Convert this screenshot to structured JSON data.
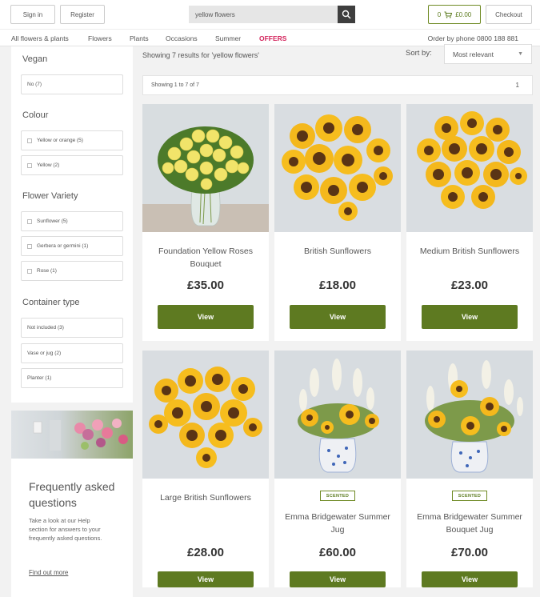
{
  "header": {
    "sign_in": "Sign in",
    "register": "Register",
    "search_value": "yellow flowers",
    "basket_count": "0",
    "basket_total": "£0.00",
    "checkout": "Checkout"
  },
  "nav": {
    "items": [
      "All flowers & plants",
      "Flowers",
      "Plants",
      "Occasions",
      "Summer",
      "OFFERS"
    ],
    "phone": "Order by phone 0800 188 881"
  },
  "filters": {
    "vegan": {
      "heading": "Vegan",
      "options": [
        "No (7)"
      ]
    },
    "colour": {
      "heading": "Colour",
      "options": [
        "Yellow or orange (5)",
        "Yellow (2)"
      ]
    },
    "variety": {
      "heading": "Flower Variety",
      "options": [
        "Sunflower (5)",
        "Gerbera or germini (1)",
        "Rose (1)"
      ]
    },
    "container": {
      "heading": "Container type",
      "options": [
        "Not included (3)",
        "Vase or jug (2)",
        "Planter (1)"
      ]
    }
  },
  "faq": {
    "title": "Frequently asked questions",
    "text": "Take a look at our Help section for answers to your frequently asked questions.",
    "link": "Find out more"
  },
  "results": {
    "summary": "Showing 7 results for 'yellow flowers'",
    "sort_label": "Sort by:",
    "sort_value": "Most relevant",
    "paging_text": "Showing 1 to 7 of 7",
    "page_number": "1"
  },
  "products": [
    {
      "name": "Foundation Yellow Roses Bouquet",
      "price": "£35.00",
      "badge": "",
      "view": "View",
      "image": "yellow-roses"
    },
    {
      "name": "British Sunflowers",
      "price": "£18.00",
      "badge": "",
      "view": "View",
      "image": "sunflowers"
    },
    {
      "name": "Medium British Sunflowers",
      "price": "£23.00",
      "badge": "",
      "view": "View",
      "image": "sunflowers-dense"
    },
    {
      "name": "Large British Sunflowers",
      "price": "£28.00",
      "badge": "",
      "view": "View",
      "image": "sunflowers-large"
    },
    {
      "name": "Emma Bridgewater Summer Jug",
      "price": "£60.00",
      "badge": "SCENTED",
      "view": "View",
      "image": "jug-bouquet"
    },
    {
      "name": "Emma Bridgewater Summer Bouquet Jug",
      "price": "£70.00",
      "badge": "SCENTED",
      "view": "View",
      "image": "jug-bouquet-2"
    }
  ],
  "colors": {
    "accent_green": "#5e7a21",
    "offers_pink": "#d3245c"
  }
}
